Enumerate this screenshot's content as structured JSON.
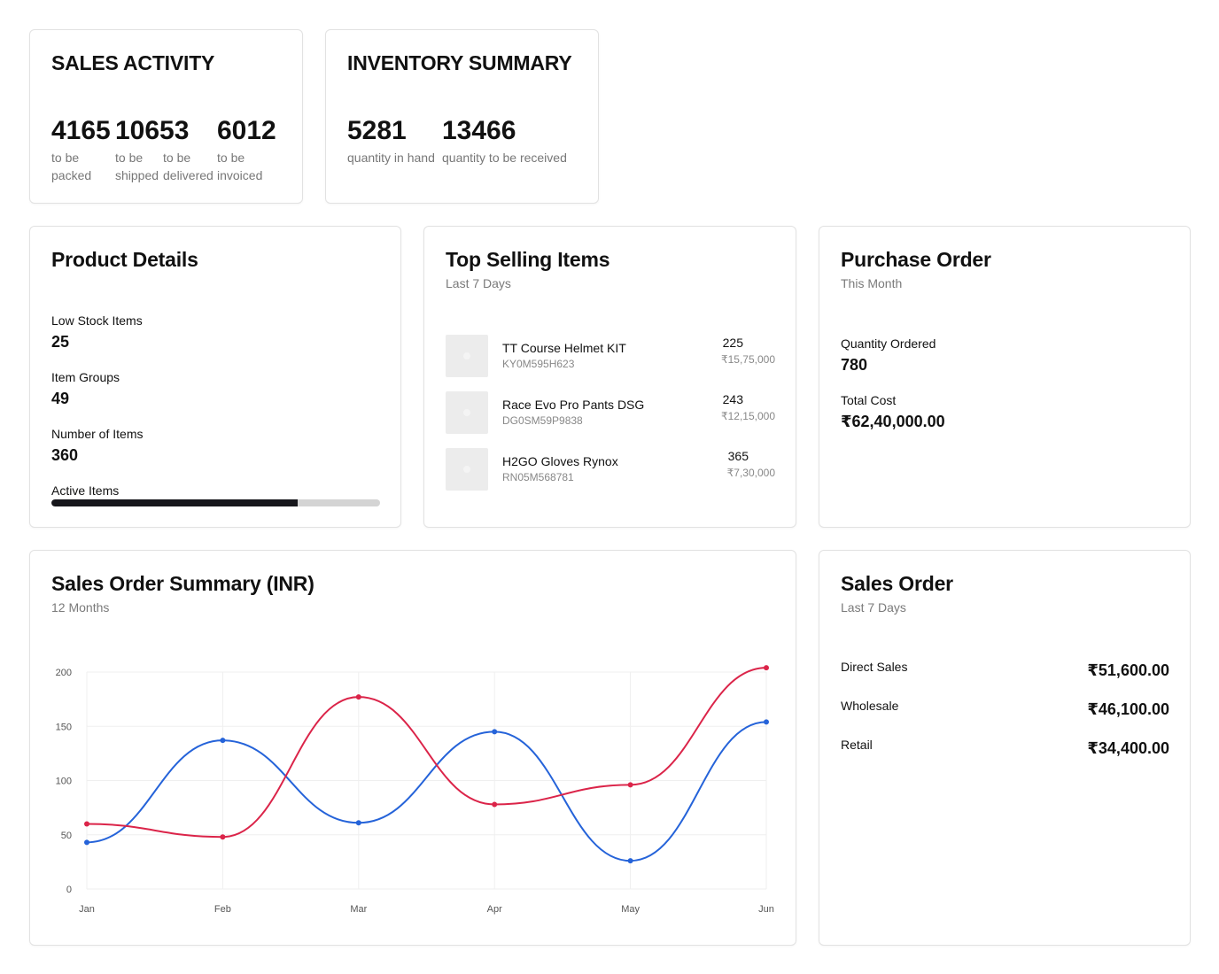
{
  "sales_activity": {
    "title": "SALES ACTIVITY",
    "stats": [
      {
        "value": "4165",
        "label_1": "to be",
        "label_2": "packed"
      },
      {
        "value": "10653",
        "label_1": "to be",
        "label_2": "shipped"
      },
      {
        "value": "",
        "label_1": "to be",
        "label_2": "delivered"
      },
      {
        "value": "6012",
        "label_1": "to be",
        "label_2": "invoiced"
      }
    ]
  },
  "inventory_summary": {
    "title": "INVENTORY SUMMARY",
    "stats": [
      {
        "value": "5281",
        "label": "quantity in hand"
      },
      {
        "value": "13466",
        "label": "quantity to be received"
      }
    ]
  },
  "product_details": {
    "title": "Product Details",
    "rows": [
      {
        "label": "Low Stock Items",
        "value": "25"
      },
      {
        "label": "Item Groups",
        "value": "49"
      },
      {
        "label": "Number of Items",
        "value": "360"
      }
    ],
    "active_label": "Active Items",
    "active_fraction": 0.75,
    "fill_color": "#16161b"
  },
  "top_selling": {
    "title": "Top Selling Items",
    "subtitle": "Last 7 Days",
    "items": [
      {
        "name": "TT Course Helmet KIT",
        "sku": "KY0M595H623",
        "qty": "225",
        "amount": "₹15,75,000"
      },
      {
        "name": "Race Evo Pro Pants DSG",
        "sku": "DG0SM59P9838",
        "qty": "243",
        "amount": "₹12,15,000"
      },
      {
        "name": "H2GO Gloves Rynox",
        "sku": "RN05M568781",
        "qty": "365",
        "amount": "₹7,30,000"
      }
    ]
  },
  "purchase_order": {
    "title": "Purchase Order",
    "subtitle": "This Month",
    "rows": [
      {
        "label": "Quantity Ordered",
        "value": "780"
      },
      {
        "label": "Total Cost",
        "value": "₹62,40,000.00"
      }
    ]
  },
  "sales_summary": {
    "title": "Sales Order Summary (INR)",
    "subtitle": "12 Months"
  },
  "chart_data": {
    "type": "line",
    "title": "Sales Order Summary (INR)",
    "subtitle": "12 Months",
    "categories": [
      "Jan",
      "Feb",
      "Mar",
      "Apr",
      "May",
      "Jun"
    ],
    "ylim": [
      0,
      200
    ],
    "yticks": [
      0,
      50,
      100,
      150,
      200
    ],
    "grid": true,
    "series": [
      {
        "color": "#2563d9",
        "values": [
          43,
          137,
          61,
          145,
          26,
          154
        ]
      },
      {
        "color": "#db2449",
        "values": [
          60,
          48,
          177,
          78,
          96,
          204
        ]
      }
    ]
  },
  "sales_order": {
    "title": "Sales Order",
    "subtitle": "Last 7 Days",
    "rows": [
      {
        "label": "Direct Sales",
        "value": "₹51,600.00"
      },
      {
        "label": "Wholesale",
        "value": "₹46,100.00"
      },
      {
        "label": "Retail",
        "value": "₹34,400.00"
      }
    ]
  }
}
